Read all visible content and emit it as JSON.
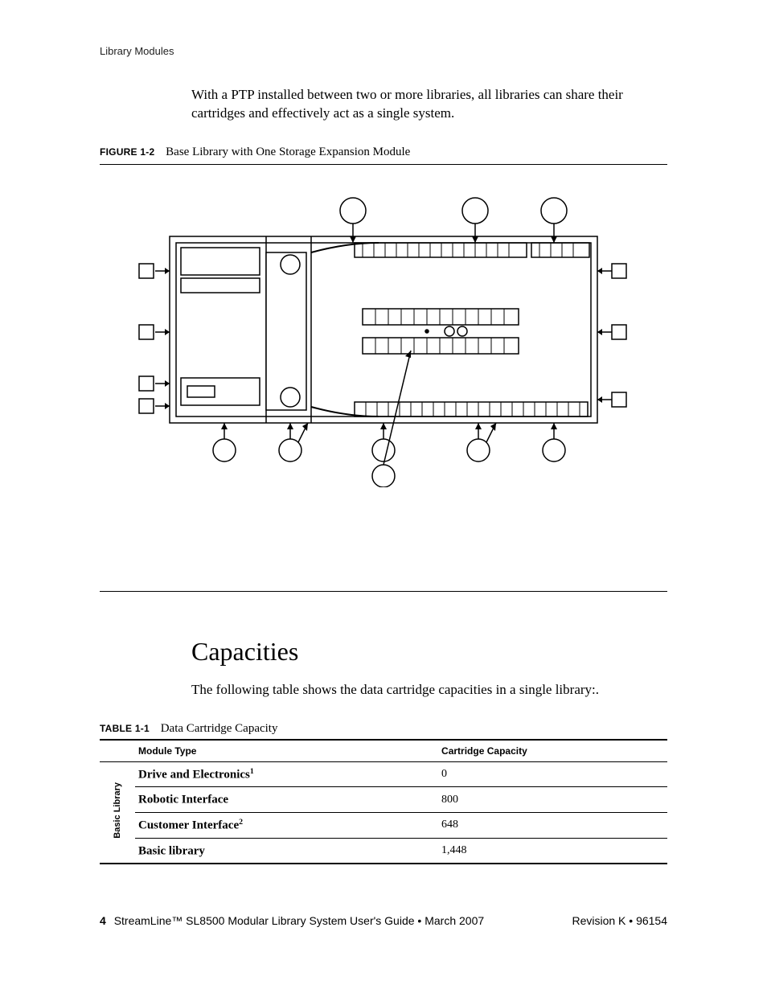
{
  "running_head": "Library Modules",
  "intro_paragraph": "With a PTP installed between two or more libraries, all libraries can share their cartridges and effectively act as a single system.",
  "figure": {
    "label": "FIGURE 1-2",
    "title": "Base Library with One Storage Expansion Module"
  },
  "section_heading": "Capacities",
  "section_lead": "The following table shows the data cartridge capacities in a single library:.",
  "table": {
    "label": "TABLE 1-1",
    "title": "Data Cartridge Capacity",
    "columns": [
      "Module Type",
      "Cartridge Capacity"
    ],
    "row_group_label": "Basic Library",
    "rows": [
      {
        "name": "Drive and Electronics",
        "sup": "1",
        "capacity": "0"
      },
      {
        "name": "Robotic Interface",
        "sup": "",
        "capacity": "800"
      },
      {
        "name": "Customer Interface",
        "sup": "2",
        "capacity": "648"
      },
      {
        "name": "Basic library",
        "sup": "",
        "capacity": "1,448"
      }
    ]
  },
  "footer": {
    "page_number": "4",
    "doc_title": "StreamLine™ SL8500 Modular Library System User's Guide  •  March 2007",
    "revision": "Revision K  •  96154"
  }
}
